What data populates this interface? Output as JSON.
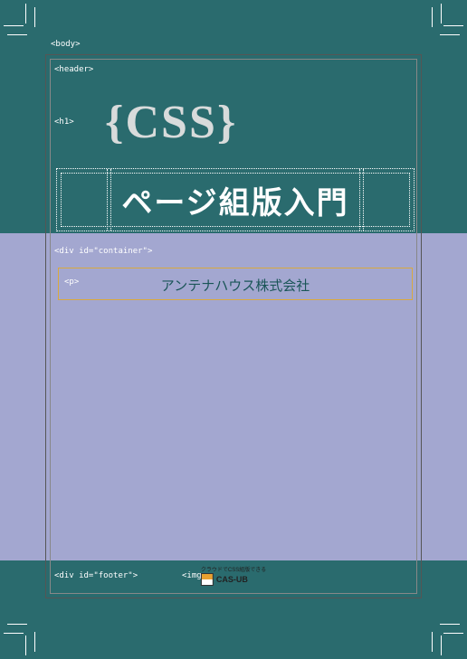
{
  "labels": {
    "body": "<body>",
    "header": "<header>",
    "h1": "<h1>",
    "container": "<div id=\"container\">",
    "p": "<p>",
    "footer": "<div id=\"footer\">",
    "img": "<img>"
  },
  "heading": {
    "logo_left": "{",
    "logo_text": "CSS",
    "logo_right": "}",
    "title": "ページ組版入門"
  },
  "company": "アンテナハウス株式会社",
  "footer_logo": {
    "tagline": "クラウドでCSS組版できる",
    "name": "CAS-UB"
  }
}
